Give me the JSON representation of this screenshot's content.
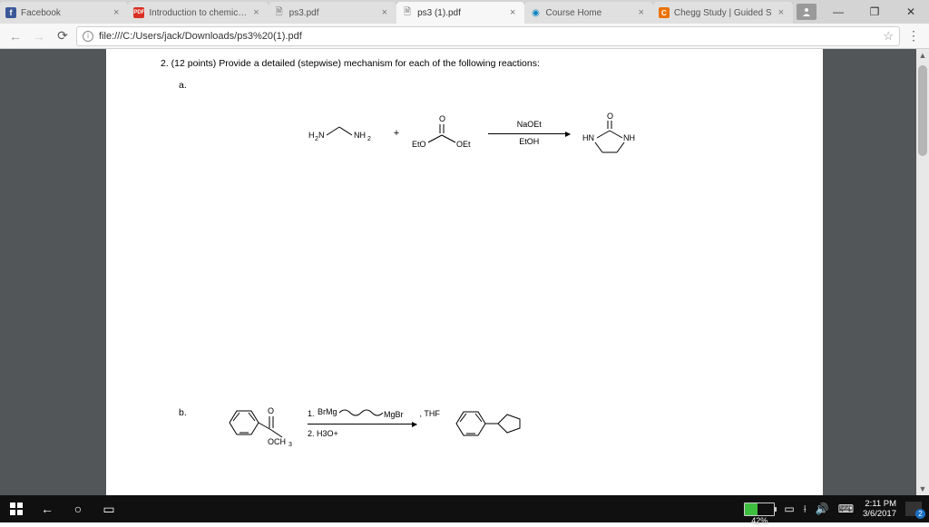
{
  "tabs": [
    {
      "label": "Facebook",
      "favBg": "#3b5998",
      "favText": "f",
      "favColor": "#fff"
    },
    {
      "label": "Introduction to chemic…",
      "favBg": "#d93025",
      "favText": "PDF",
      "favColor": "#fff"
    },
    {
      "label": "ps3.pdf",
      "favBg": "transparent",
      "favText": "🗎",
      "favColor": "#777"
    },
    {
      "label": "ps3 (1).pdf",
      "favBg": "transparent",
      "favText": "🗎",
      "favColor": "#777",
      "active": true
    },
    {
      "label": "Course Home",
      "favBg": "transparent",
      "favText": "◉",
      "favColor": "#0a84c1"
    },
    {
      "label": "Chegg Study | Guided S",
      "favBg": "#eb7100",
      "favText": "C",
      "favColor": "#fff"
    }
  ],
  "url": "file:///C:/Users/jack/Downloads/ps3%20(1).pdf",
  "doc": {
    "question": "2. (12 points) Provide a detailed (stepwise) mechanism for each of the following reactions:",
    "partA": "a.",
    "partB": "b.",
    "rxnA": {
      "reagent1_left": "H",
      "reagent1_left2": "N",
      "reagent1_right": "NH",
      "plus": "+",
      "carbonate_left": "EtO",
      "carbonate_right": "OEt",
      "carbonate_top": "O",
      "cond_top": "NaOEt",
      "cond_bot": "EtOH",
      "prod_left": "HN",
      "prod_right": "NH",
      "prod_top": "O"
    },
    "rxnB": {
      "sm_sub": "OCH",
      "sm_sub3": "3",
      "sm_o": "O",
      "step1_num": "1.",
      "step1_left": "BrMg",
      "step1_right": "MgBr",
      "step1_solv": ", THF",
      "step2": "2. H",
      "step2_sub": "3",
      "step2_tail": "O+"
    }
  },
  "battery": {
    "pct": "42%",
    "fill": 42
  },
  "clock": {
    "time": "2:11 PM",
    "date": "3/6/2017"
  },
  "notif_count": "2"
}
